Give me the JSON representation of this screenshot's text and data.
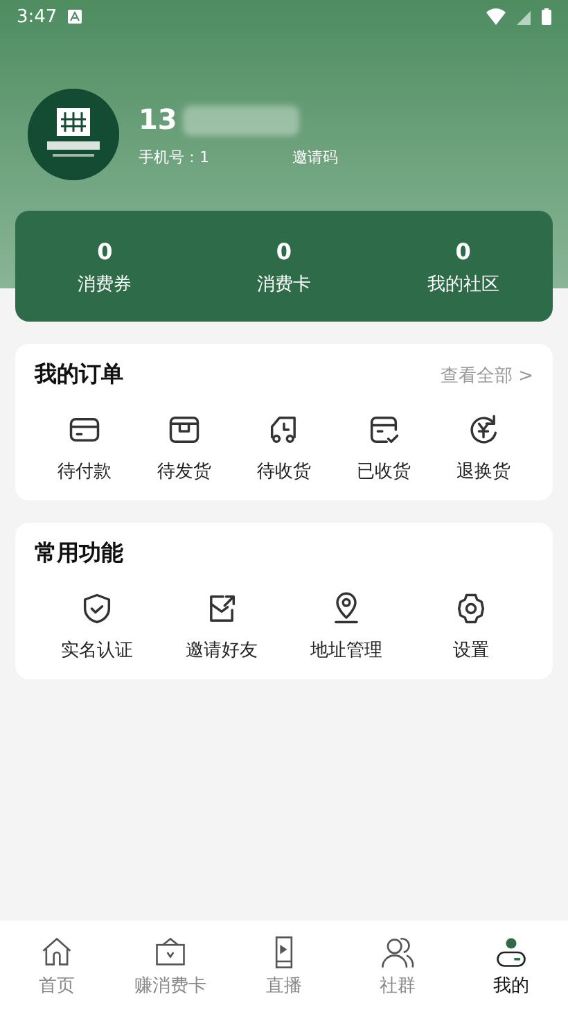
{
  "status_bar": {
    "time": "3:47"
  },
  "profile": {
    "name": "13",
    "phone_label": "手机号：1",
    "invite_label": "邀请码"
  },
  "stats": [
    {
      "value": "0",
      "label": "消费券"
    },
    {
      "value": "0",
      "label": "消费卡"
    },
    {
      "value": "0",
      "label": "我的社区"
    }
  ],
  "orders": {
    "title": "我的订单",
    "view_all": "查看全部 >",
    "items": [
      {
        "kind": "card",
        "label": "待付款"
      },
      {
        "kind": "box",
        "label": "待发货"
      },
      {
        "kind": "truck",
        "label": "待收货"
      },
      {
        "kind": "received",
        "label": "已收货"
      },
      {
        "kind": "refund",
        "label": "退换货"
      }
    ]
  },
  "functions": {
    "title": "常用功能",
    "items": [
      {
        "kind": "shield",
        "label": "实名认证"
      },
      {
        "kind": "share",
        "label": "邀请好友"
      },
      {
        "kind": "pin",
        "label": "地址管理"
      },
      {
        "kind": "gear",
        "label": "设置"
      }
    ]
  },
  "tabs": [
    {
      "kind": "home",
      "label": "首页",
      "selected": false
    },
    {
      "kind": "card",
      "label": "赚消费卡",
      "selected": false
    },
    {
      "kind": "live",
      "label": "直播",
      "selected": false
    },
    {
      "kind": "people",
      "label": "社群",
      "selected": false
    },
    {
      "kind": "me",
      "label": "我的",
      "selected": true
    }
  ]
}
